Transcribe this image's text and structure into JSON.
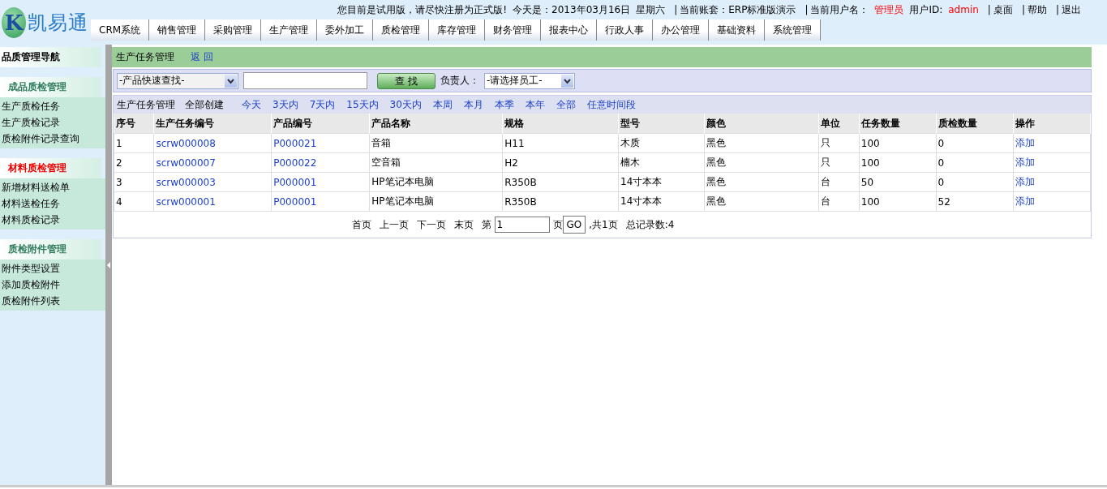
{
  "header": {
    "logo_letter": "K",
    "logo_text": "凯易通",
    "info": [
      {
        "text": "您目前是试用版，请尽快注册为正式版!",
        "kind": "text"
      },
      {
        "text": "今天是：2013年03月16日",
        "kind": "text"
      },
      {
        "text": "星期六",
        "kind": "text"
      },
      {
        "text": "|",
        "kind": "sep"
      },
      {
        "text": "当前账套：ERP标准版演示",
        "kind": "text"
      },
      {
        "text": "|",
        "kind": "sep"
      },
      {
        "text": "当前用户名：",
        "kind": "text"
      },
      {
        "text": "管理员",
        "kind": "value"
      },
      {
        "text": "用户ID:",
        "kind": "text"
      },
      {
        "text": "admin",
        "kind": "value"
      },
      {
        "text": "|",
        "kind": "sep"
      },
      {
        "text": "桌面",
        "kind": "link"
      },
      {
        "text": "|",
        "kind": "sep"
      },
      {
        "text": "帮助",
        "kind": "link"
      },
      {
        "text": "|",
        "kind": "sep"
      },
      {
        "text": "退出",
        "kind": "link"
      }
    ],
    "nav": [
      "CRM系统",
      "销售管理",
      "采购管理",
      "生产管理",
      "委外加工",
      "质检管理",
      "库存管理",
      "财务管理",
      "报表中心",
      "行政人事",
      "办公管理",
      "基础资料",
      "系统管理"
    ]
  },
  "sidebar": {
    "title": "品质管理导航",
    "sections": [
      {
        "heading": "成品质检管理",
        "highlighted": false,
        "items": [
          "生产质检任务",
          "生产质检记录",
          "质检附件记录查询"
        ]
      },
      {
        "heading": "材料质检管理",
        "highlighted": true,
        "items": [
          "新增材料送检单",
          "材料送检任务",
          "材料质检记录"
        ]
      },
      {
        "heading": "质检附件管理",
        "highlighted": false,
        "items": [
          "附件类型设置",
          "添加质检附件",
          "质检附件列表"
        ]
      }
    ]
  },
  "page": {
    "title": "生产任务管理",
    "back": "返 回"
  },
  "search": {
    "product_select": "-产品快速查找-",
    "button": "查 找",
    "owner_label": "负责人：",
    "owner_select": "-请选择员工-"
  },
  "filters": [
    {
      "text": "生产任务管理",
      "kind": "text"
    },
    {
      "text": "全部创建",
      "kind": "text"
    },
    {
      "text": "今天",
      "kind": "link"
    },
    {
      "text": "3天内",
      "kind": "link"
    },
    {
      "text": "7天内",
      "kind": "link"
    },
    {
      "text": "15天内",
      "kind": "link"
    },
    {
      "text": "30天内",
      "kind": "link"
    },
    {
      "text": "本周",
      "kind": "link"
    },
    {
      "text": "本月",
      "kind": "link"
    },
    {
      "text": "本季",
      "kind": "link"
    },
    {
      "text": "本年",
      "kind": "link"
    },
    {
      "text": "全部",
      "kind": "link"
    },
    {
      "text": "任意时间段",
      "kind": "link"
    }
  ],
  "table": {
    "columns": [
      {
        "label": "序号",
        "kind": "text"
      },
      {
        "label": "生产任务编号",
        "kind": "link"
      },
      {
        "label": "产品编号",
        "kind": "link"
      },
      {
        "label": "产品名称",
        "kind": "text"
      },
      {
        "label": "规格",
        "kind": "text"
      },
      {
        "label": "型号",
        "kind": "text"
      },
      {
        "label": "颜色",
        "kind": "text"
      },
      {
        "label": "单位",
        "kind": "text"
      },
      {
        "label": "任务数量",
        "kind": "text"
      },
      {
        "label": "质检数量",
        "kind": "text"
      },
      {
        "label": "操作",
        "kind": "link"
      }
    ],
    "rows": [
      [
        "1",
        "scrw000008",
        "P000021",
        "音箱",
        "H11",
        "木质",
        "黑色",
        "只",
        "100",
        "0",
        "添加"
      ],
      [
        "2",
        "scrw000007",
        "P000022",
        "空音箱",
        "H2",
        "楠木",
        "黑色",
        "只",
        "100",
        "0",
        "添加"
      ],
      [
        "3",
        "scrw000003",
        "P000001",
        "HP笔记本电脑",
        "R350B",
        "14寸本本",
        "黑色",
        "台",
        "50",
        "0",
        "添加"
      ],
      [
        "4",
        "scrw000001",
        "P000001",
        "HP笔记本电脑",
        "R350B",
        "14寸本本",
        "黑色",
        "台",
        "100",
        "52",
        "添加"
      ]
    ]
  },
  "pager": {
    "links": [
      "首页",
      "上一页",
      "下一页",
      "末页"
    ],
    "page_prefix": "第",
    "page_value": "1",
    "page_suffix": "页",
    "go": "GO",
    "total_pages": ",共1页",
    "total_records": "总记录数:4"
  }
}
